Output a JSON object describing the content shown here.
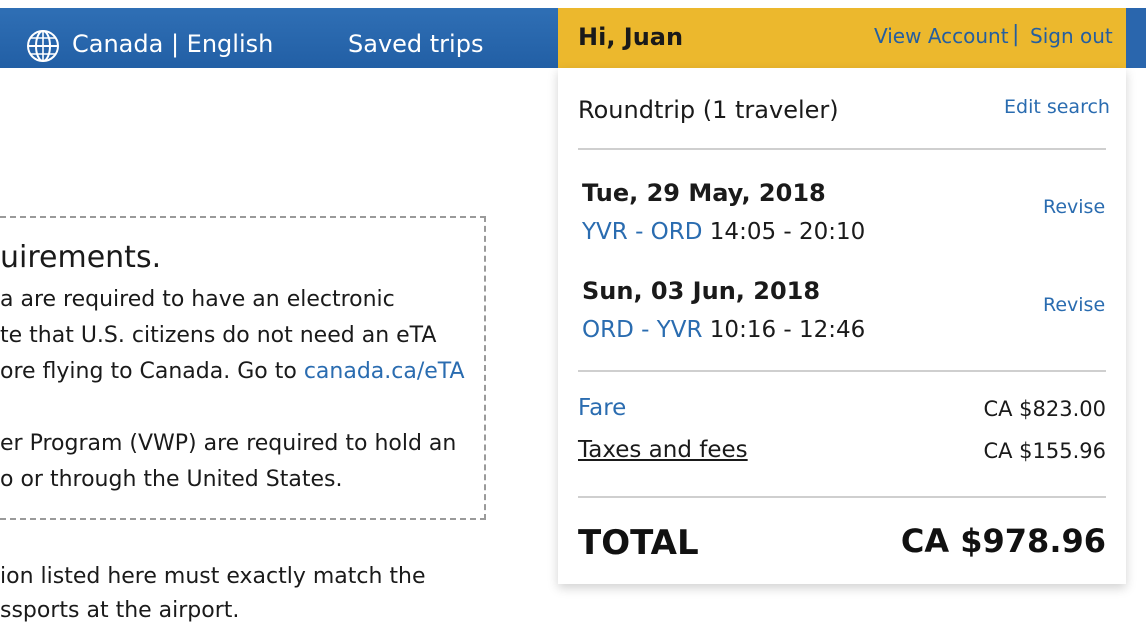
{
  "nav": {
    "locale_icon": "globe-icon",
    "locale": "Canada | English",
    "saved_trips": "Saved trips"
  },
  "user": {
    "greeting": "Hi, Juan",
    "view_account": "View Account",
    "separator": "|",
    "sign_out": "Sign out"
  },
  "requirements": {
    "title": "uirements.",
    "lines": [
      "a are required to have an electronic",
      "te that U.S. citizens do not need an eTA",
      "ore flying to Canada. Go to ",
      "er Program (VWP) are required to hold an",
      "o or through the United States."
    ],
    "link": "canada.ca/eTA",
    "footer": "ion listed here must exactly match the",
    "footer_cut": "ssports at the airport."
  },
  "summary": {
    "trip_type": "Roundtrip (1 traveler)",
    "edit_search": "Edit search",
    "flights": [
      {
        "date": "Tue, 29 May, 2018",
        "route": "YVR - ORD",
        "times": "14:05 - 20:10",
        "revise": "Revise"
      },
      {
        "date": "Sun, 03 Jun, 2018",
        "route": "ORD - YVR",
        "times": "10:16 - 12:46",
        "revise": "Revise"
      }
    ],
    "fare_label": "Fare",
    "fare_amount": "CA $823.00",
    "taxes_label": "Taxes and fees",
    "taxes_amount": "CA $155.96",
    "total_label": "TOTAL",
    "total_amount": "CA $978.96"
  },
  "colors": {
    "nav_blue": "#2a66ad",
    "user_bar_gold": "#ecb82d",
    "link_blue": "#2a6cb0"
  }
}
